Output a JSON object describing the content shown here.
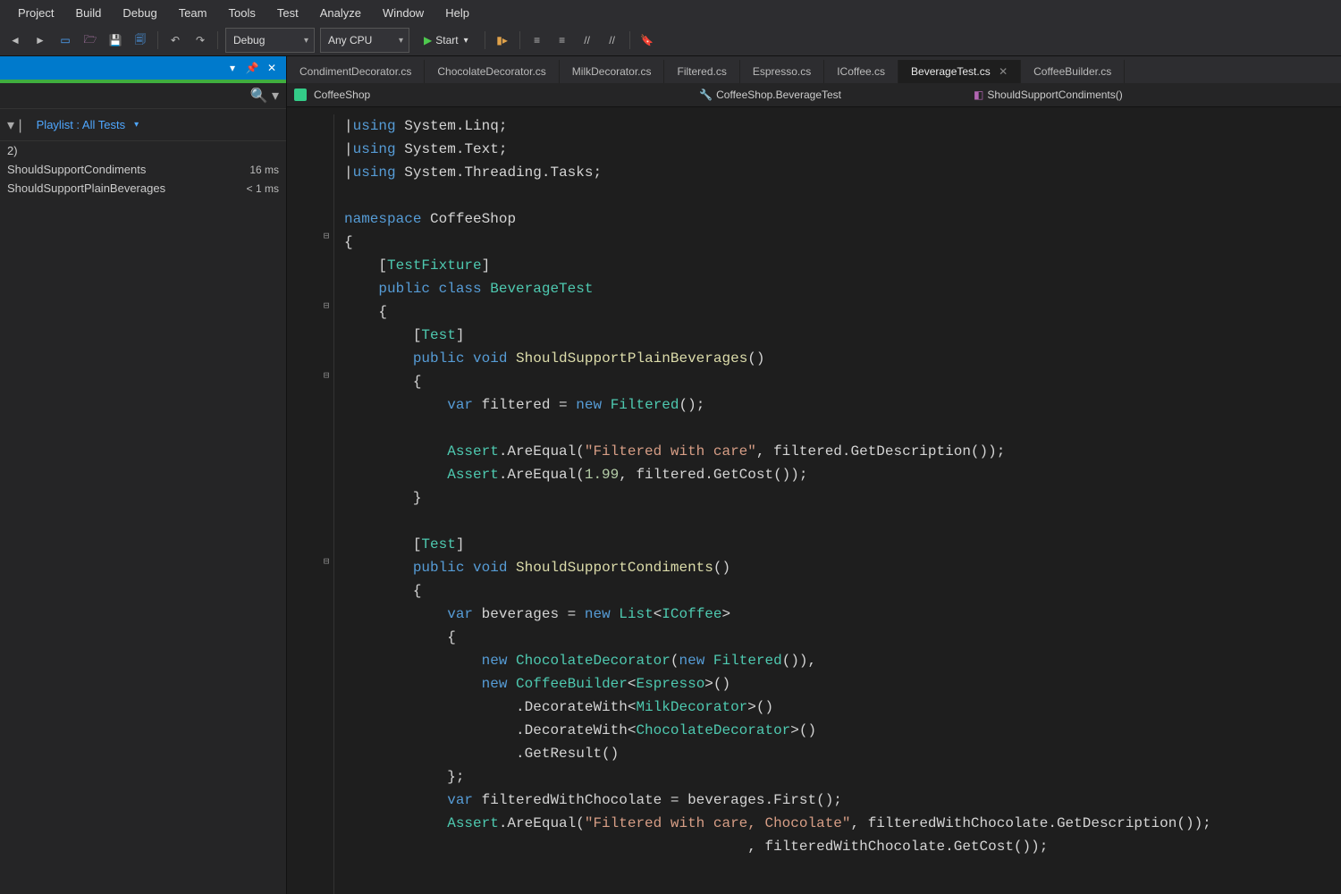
{
  "menu": {
    "items": [
      "Project",
      "Build",
      "Debug",
      "Team",
      "Tools",
      "Test",
      "Analyze",
      "Window",
      "Help"
    ]
  },
  "toolbar": {
    "config": "Debug",
    "platform": "Any CPU",
    "start": "Start"
  },
  "sidebar": {
    "search_placeholder": "Search",
    "playlist": "Playlist : All Tests",
    "group_count": "2)",
    "tests": [
      {
        "name": "ShouldSupportCondiments",
        "time": "16 ms"
      },
      {
        "name": "ShouldSupportPlainBeverages",
        "time": "< 1 ms"
      }
    ]
  },
  "tabs": [
    "CondimentDecorator.cs",
    "ChocolateDecorator.cs",
    "MilkDecorator.cs",
    "Filtered.cs",
    "Espresso.cs",
    "ICoffee.cs",
    "BeverageTest.cs",
    "CoffeeBuilder.cs"
  ],
  "subbar": {
    "project": "CoffeeShop",
    "namespace": "CoffeeShop.BeverageTest",
    "method": "ShouldSupportCondiments()"
  },
  "code": {
    "usings": [
      "System.Linq",
      "System.Text",
      "System.Threading.Tasks"
    ],
    "namespace": "CoffeeShop",
    "attr1": "TestFixture",
    "class_kw": "public class",
    "class_name": "BeverageTest",
    "test_attr": "Test",
    "m1_sig": "public void ShouldSupportPlainBeverages()",
    "m1_l1_a": "var",
    "m1_l1_b": "filtered = ",
    "m1_l1_c": "new",
    "m1_l1_d": "Filtered",
    "m1_l1_e": "();",
    "m1_l2_a": "Assert",
    "m1_l2_b": ".AreEqual(",
    "m1_l2_c": "\"Filtered with care\"",
    "m1_l2_d": ", filtered.GetDescription());",
    "m1_l3_a": "Assert",
    "m1_l3_b": ".AreEqual(",
    "m1_l3_c": "1.99",
    "m1_l3_d": ", filtered.GetCost());",
    "m2_sig": "public void ShouldSupportCondiments()",
    "m2_l1_a": "var",
    "m2_l1_b": "beverages = ",
    "m2_l1_c": "new",
    "m2_l1_d": "List",
    "m2_l1_e": "ICoffee",
    "m2_l2_a": "new",
    "m2_l2_b": "ChocolateDecorator",
    "m2_l2_c": "new",
    "m2_l2_d": "Filtered",
    "m2_l2_e": "()),",
    "m2_l3_a": "new",
    "m2_l3_b": "CoffeeBuilder",
    "m2_l3_c": "Espresso",
    "m2_l3_d": "()",
    "m2_l4_a": ".DecorateWith<",
    "m2_l4_b": "MilkDecorator",
    "m2_l4_c": ">()",
    "m2_l5_a": ".DecorateWith<",
    "m2_l5_b": "ChocolateDecorator",
    "m2_l5_c": ">()",
    "m2_l6": ".GetResult()",
    "m2_l7": "};",
    "m2_l8_a": "var",
    "m2_l8_b": "filteredWithChocolate = beverages.First();",
    "m2_l9_a": "Assert",
    "m2_l9_b": ".AreEqual(",
    "m2_l9_c": "\"Filtered with care, Chocolate\"",
    "m2_l9_d": ", filteredWithChocolate.GetDescription());",
    "m2_l10_d": ", filteredWithChocolate.GetCost());"
  }
}
